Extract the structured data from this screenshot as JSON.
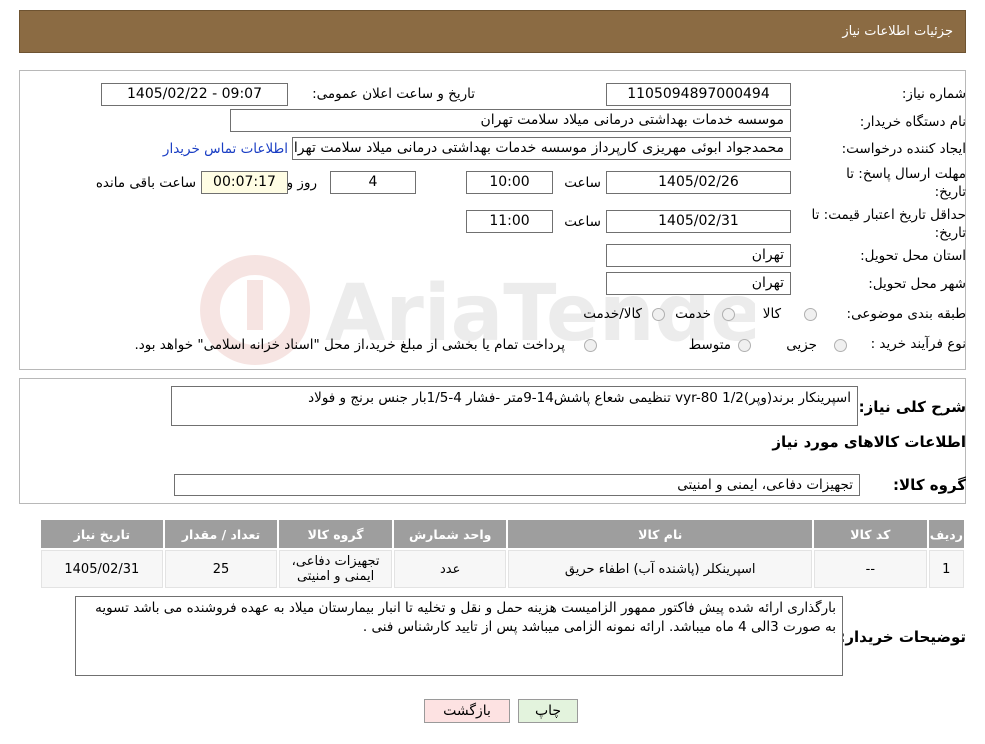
{
  "header": {
    "title": "جزئیات اطلاعات نیاز"
  },
  "need_number": {
    "label": "شماره نیاز:",
    "value": "1105094897000494"
  },
  "announce": {
    "label": "تاریخ و ساعت اعلان عمومی:",
    "value": "1405/02/22 - 09:07"
  },
  "buyer_org": {
    "label": "نام دستگاه خریدار:",
    "value": "موسسه خدمات بهداشتی درمانی میلاد سلامت تهران"
  },
  "creator": {
    "label": "ایجاد کننده درخواست:",
    "value": "محمدجواد ابوئی مهریزی کارپرداز موسسه خدمات بهداشتی درمانی میلاد سلامت تهران",
    "contact_link": "اطلاعات تماس خریدار"
  },
  "reply_deadline": {
    "label_line1": "مهلت ارسال پاسخ: تا",
    "label_line2": "تاریخ:",
    "date": "1405/02/26",
    "time_label": "ساعت",
    "time": "10:00",
    "days": "4",
    "days_label": "روز و",
    "remaining": "00:07:17",
    "remaining_label": "ساعت باقی مانده"
  },
  "price_validity": {
    "label_line1": "حداقل تاریخ اعتبار قیمت: تا",
    "label_line2": "تاریخ:",
    "date": "1405/02/31",
    "time_label": "ساعت",
    "time": "11:00"
  },
  "province": {
    "label": "استان محل تحویل:",
    "value": "تهران"
  },
  "city": {
    "label": "شهر محل تحویل:",
    "value": "تهران"
  },
  "category": {
    "label": "طبقه بندی موضوعی:",
    "options": [
      "کالا",
      "خدمت",
      "کالا/خدمت"
    ]
  },
  "process": {
    "label": "نوع فرآیند خرید :",
    "options": [
      "جزیی",
      "متوسط"
    ],
    "note": "پرداخت تمام یا بخشی از مبلغ خرید،از محل \"اسناد خزانه اسلامی\" خواهد بود."
  },
  "description": {
    "label": "شرح کلی نیاز:",
    "value": "اسپرینکار برند(وپر)vyr-80 1/2 تنظیمی شعاع پاشش14-9متر -فشار 4-1/5بار جنس برنج و فولاد"
  },
  "goods_info_title": "اطلاعات کالاهای مورد نیاز",
  "goods_group": {
    "label": "گروه کالا:",
    "value": "تجهیزات دفاعی، ایمنی و امنیتی"
  },
  "table": {
    "headers": [
      "ردیف",
      "کد کالا",
      "نام کالا",
      "واحد شمارش",
      "گروه کالا",
      "تعداد / مقدار",
      "تاریخ نیاز"
    ],
    "rows": [
      {
        "row": "1",
        "code": "--",
        "name": "اسپرینکلر (پاشنده آب) اطفاء حریق",
        "unit": "عدد",
        "group_line1": "تجهیزات دفاعی،",
        "group_line2": "ایمنی و امنیتی",
        "qty": "25",
        "date": "1405/02/31"
      }
    ]
  },
  "buyer_notes": {
    "label": "توضیحات خریدار:",
    "value": "بارگذاری ارائه شده پیش فاکتور ممهور الزامیست هزینه حمل و نقل و تخلیه تا انبار بیمارستان میلاد به عهده فروشنده می باشد تسویه به صورت 3الی 4 ماه میباشد. ارائه نمونه الزامی میباشد پس از تایید کارشناس فنی ."
  },
  "buttons": {
    "print": "چاپ",
    "back": "بازگشت"
  },
  "colors": {
    "header_bg": "#8b6b43",
    "back_button_bg": "#fde2e2",
    "print_button_bg": "#e3f3dd"
  }
}
